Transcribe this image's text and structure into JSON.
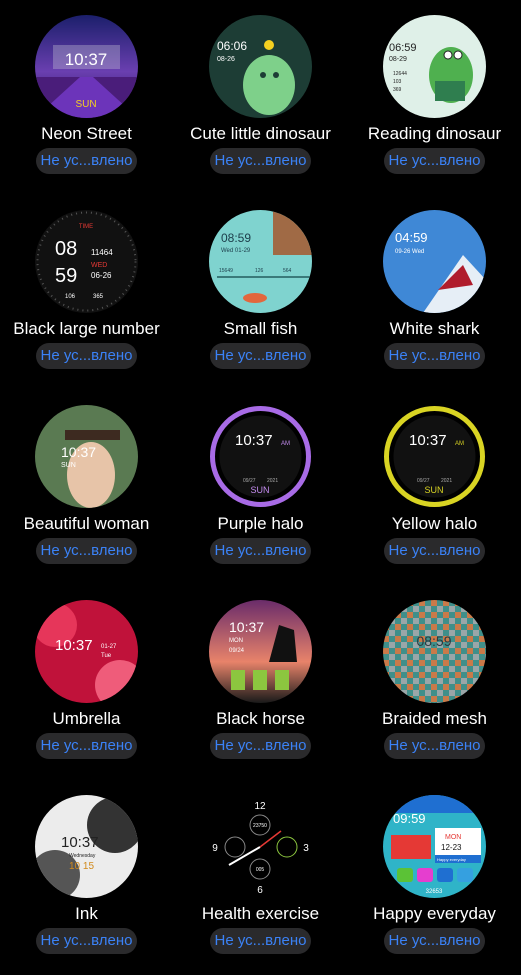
{
  "status_label": "Не ус...влено",
  "faces": [
    {
      "name": "Neon Street",
      "icon": "neon-street-face",
      "time": "10:37",
      "day": "SUN"
    },
    {
      "name": "Cute little dinosaur",
      "icon": "dinosaur-face",
      "time": "06:06",
      "date": "08-26"
    },
    {
      "name": "Reading dinosaur",
      "icon": "reading-dinosaur-face",
      "time": "06:59",
      "date": "08-29",
      "steps": "12644",
      "kcal": "103",
      "km": "369"
    },
    {
      "name": "Black large number",
      "icon": "large-number-face",
      "hour": "08",
      "minute": "59",
      "label_time": "TIME",
      "steps": "11464",
      "weekday": "WED",
      "date": "06-26",
      "heart": "106",
      "cal": "365"
    },
    {
      "name": "Small fish",
      "icon": "fish-face",
      "time": "08:59",
      "date": "Wed 01-29",
      "steps": "15649",
      "heart": "126",
      "kcal": "564"
    },
    {
      "name": "White shark",
      "icon": "shark-face",
      "time": "04:59",
      "date": "09-26 Wed"
    },
    {
      "name": "Beautiful woman",
      "icon": "woman-face",
      "time": "10:37",
      "day": "SUN"
    },
    {
      "name": "Purple halo",
      "icon": "purple-halo-face",
      "time": "10:37",
      "ampm": "AM",
      "date": "09/27",
      "year": "2021",
      "day": "SUN"
    },
    {
      "name": "Yellow halo",
      "icon": "yellow-halo-face",
      "time": "10:37",
      "ampm": "AM",
      "date": "09/27",
      "year": "2021",
      "day": "SUN"
    },
    {
      "name": "Umbrella",
      "icon": "umbrella-face",
      "time": "10:37",
      "date": "01-27",
      "weekday": "Tue"
    },
    {
      "name": "Black horse",
      "icon": "horse-face",
      "time": "10:37",
      "weekday": "MON",
      "date": "09/24"
    },
    {
      "name": "Braided mesh",
      "icon": "mesh-face",
      "time": "08:59"
    },
    {
      "name": "Ink",
      "icon": "ink-face",
      "time": "10:37",
      "weekday": "Wednesday",
      "date": "10 15"
    },
    {
      "name": "Health exercise",
      "icon": "health-exercise-face",
      "n12": "12",
      "n3": "3",
      "n6": "6",
      "n9": "9",
      "steps": "23750",
      "bpm": "005"
    },
    {
      "name": "Happy everyday",
      "icon": "happy-everyday-face",
      "time": "09:59",
      "weekday": "MON",
      "date": "12-23",
      "caption": "Happy everyday",
      "steps": "32653"
    }
  ]
}
